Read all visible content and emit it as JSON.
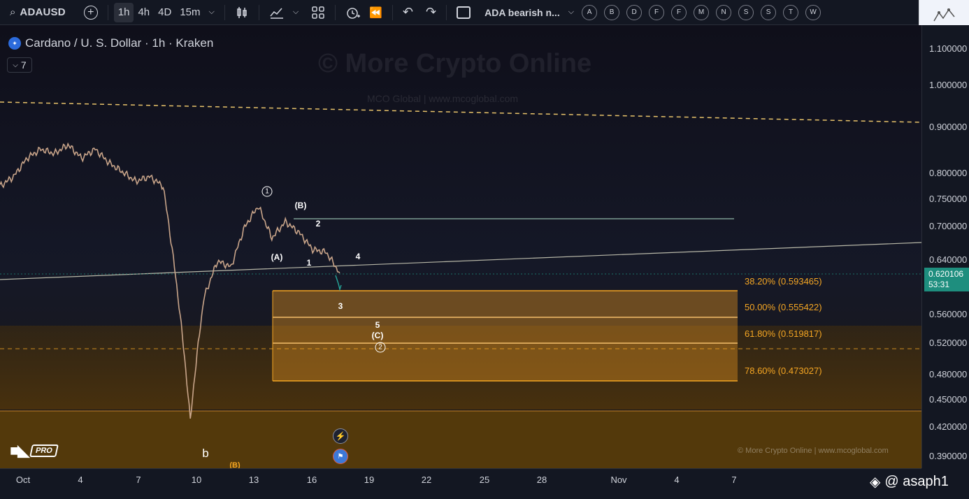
{
  "toolbar": {
    "symbol": "ADAUSD",
    "intervals": [
      "1h",
      "4h",
      "4D",
      "15m"
    ],
    "active_interval": "1h",
    "layout_name": "ADA bearish n...",
    "quick_buttons": [
      "A",
      "B",
      "D",
      "F",
      "F",
      "M",
      "N",
      "S",
      "S",
      "T",
      "W"
    ]
  },
  "legend": {
    "title": "Cardano / U. S. Dollar · 1h · Kraken",
    "indicator_count": "7"
  },
  "watermark": {
    "main": "© More Crypto Online",
    "sub": "MCO Global  |  www.mcoglobal.com",
    "bottom": "© More Crypto Online  |  www.mcoglobal.com"
  },
  "price_axis": {
    "labels": [
      "1.100000",
      "1.000000",
      "0.900000",
      "0.800000",
      "0.750000",
      "0.700000",
      "0.640000",
      "0.560000",
      "0.520000",
      "0.480000",
      "0.450000",
      "0.420000",
      "0.390000"
    ],
    "current_price": "0.620106",
    "countdown": "53:31"
  },
  "time_axis": {
    "labels": [
      "Oct",
      "4",
      "7",
      "10",
      "13",
      "16",
      "19",
      "22",
      "25",
      "28",
      "Nov",
      "4",
      "7"
    ]
  },
  "fib_levels": [
    {
      "label": "38.20% (0.593465)"
    },
    {
      "label": "50.00% (0.555422)"
    },
    {
      "label": "61.80% (0.519817)"
    },
    {
      "label": "78.60% (0.473027)"
    }
  ],
  "wave_labels": {
    "w1_circle": "1",
    "B_top": "(B)",
    "two": "2",
    "A": "(A)",
    "one": "1",
    "four": "4",
    "three": "3",
    "five": "5",
    "C": "(C)",
    "w2_circle": "2",
    "small_b": "b",
    "B_bottom": "(B)"
  },
  "branding": {
    "tv_pro": "PRO",
    "user": "@ asaph1"
  },
  "chart_data": {
    "type": "line",
    "title": "Cardano / U. S. Dollar · 1h · Kraken",
    "xlabel": "",
    "ylabel": "",
    "y_scale": "log",
    "ylim": [
      0.38,
      1.15
    ],
    "categories": [
      "Oct",
      "4",
      "7",
      "10",
      "13",
      "16",
      "19",
      "22",
      "25",
      "28",
      "Nov",
      "4",
      "7"
    ],
    "series": [
      {
        "values": [
          0.78,
          0.8,
          0.84,
          0.86,
          0.85,
          0.87,
          0.84,
          0.86,
          0.83,
          0.81,
          0.79,
          0.8,
          0.78,
          0.6,
          0.42,
          0.58,
          0.64,
          0.63,
          0.7,
          0.74,
          0.68,
          0.71,
          0.69,
          0.66,
          0.655,
          0.62
        ]
      }
    ],
    "colors": {
      "candle_up": "#26a69a",
      "candle_down": "#ef5350",
      "fib": "#f5a623",
      "current_price": "#1e8e7e"
    }
  }
}
